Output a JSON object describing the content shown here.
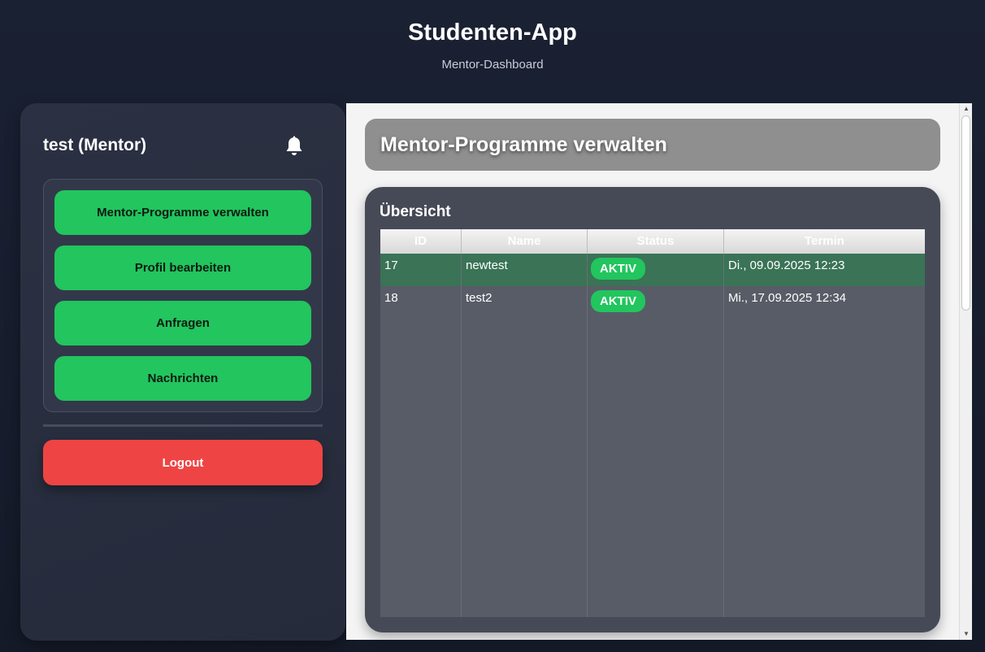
{
  "header": {
    "title": "Studenten-App",
    "subtitle": "Mentor-Dashboard"
  },
  "sidebar": {
    "user_name": "test (Mentor)",
    "notification_icon": "bell-icon",
    "menu": [
      {
        "label": "Mentor-Programme verwalten"
      },
      {
        "label": "Profil bearbeiten"
      },
      {
        "label": "Anfragen"
      },
      {
        "label": "Nachrichten"
      }
    ],
    "logout_label": "Logout"
  },
  "main": {
    "page_title": "Mentor-Programme verwalten",
    "overview": {
      "title": "Übersicht",
      "columns": [
        "ID",
        "Name",
        "Status",
        "Termin"
      ],
      "rows": [
        {
          "id": "17",
          "name": "newtest",
          "status": "AKTIV",
          "termin": "Di., 09.09.2025  12:23",
          "selected": true
        },
        {
          "id": "18",
          "name": "test2",
          "status": "AKTIV",
          "termin": "Mi., 17.09.2025  12:34",
          "selected": false
        }
      ]
    }
  },
  "colors": {
    "accent_green": "#22c55e",
    "logout_red": "#ef4444",
    "selected_row": "#3a7356"
  }
}
